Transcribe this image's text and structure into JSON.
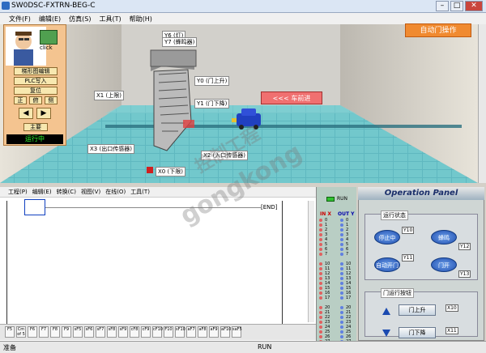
{
  "app": {
    "title": "SW0DSC-FXTRN-BEG-C"
  },
  "menubar": [
    "文件(F)",
    "编辑(E)",
    "仿真(S)",
    "工具(T)",
    "帮助(H)"
  ],
  "scene": {
    "auto_door_label": "自动门操作",
    "car_forward_label": "<<<  车前进",
    "labels": {
      "y6": "Y6 (灯)",
      "y7": "Y7 (蜂鸣器)",
      "y0": "Y0 (门上升)",
      "y1": "Y1 (门下降)",
      "x1": "X1 (上限)",
      "x3": "X3 (出口传感器)",
      "x2": "X2 (入口传感器)",
      "x0": "X0 (下限)"
    }
  },
  "left_panel": {
    "click_label": "click",
    "btn_ladder": "梯形图编辑",
    "btn_plc_write": "PLC写入",
    "btn_reset": "复位",
    "view_front": "正",
    "view_top": "俯",
    "view_side": "侧",
    "btn_main": "主要",
    "running": "运行中"
  },
  "editor": {
    "menu": [
      "工程(P)",
      "编辑(E)",
      "转换(C)",
      "视图(V)",
      "在线(O)",
      "工具(T)"
    ],
    "end_label": "[END]",
    "inst_buttons": [
      "F5",
      "Cm of 5",
      "F6",
      "F7",
      "F8",
      "F9",
      "sF5",
      "sF6",
      "sF7",
      "sF8",
      "sF9",
      "cF8",
      "cF9",
      "cF10",
      "F10",
      "sF10",
      "aF7",
      "aF8",
      "aF9",
      "aF10",
      "saF5"
    ]
  },
  "io_panel": {
    "run_label": "RUN",
    "in_label": "IN X",
    "out_label": "OUT Y",
    "nums_a": [
      "0",
      "1",
      "2",
      "3",
      "4",
      "5",
      "6",
      "7"
    ],
    "nums_b": [
      "10",
      "11",
      "12",
      "13",
      "14",
      "15",
      "16",
      "17"
    ],
    "nums_c": [
      "20",
      "21",
      "22",
      "23",
      "24",
      "25",
      "26",
      "27"
    ]
  },
  "operation_panel": {
    "title": "Operation Panel",
    "status_group": "运行状态",
    "btn_stop": "停止中",
    "btn_buzzer": "蜂鸣",
    "btn_auto": "自动开门",
    "btn_door": "门开",
    "tags": {
      "y10": "Y10",
      "y12": "Y12",
      "y11": "Y11",
      "y13": "Y13",
      "x10": "X10",
      "x11": "X11"
    },
    "control_group": "门运行按钮",
    "btn_up": "门上升",
    "btn_down": "门下降"
  },
  "status": {
    "left": "准备",
    "right": "RUN"
  },
  "watermark": {
    "line1": "控制工程",
    "line2": "gongkong"
  }
}
